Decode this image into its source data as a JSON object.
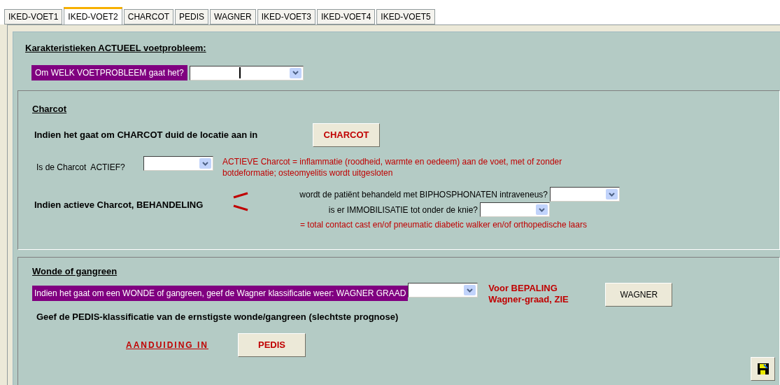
{
  "tabs": [
    {
      "label": "IKED-VOET1",
      "selected": false
    },
    {
      "label": "IKED-VOET2",
      "selected": true
    },
    {
      "label": "CHARCOT",
      "selected": false
    },
    {
      "label": "PEDIS",
      "selected": false
    },
    {
      "label": "WAGNER",
      "selected": false
    },
    {
      "label": "IKED-VOET3",
      "selected": false
    },
    {
      "label": "IKED-VOET4",
      "selected": false
    },
    {
      "label": "IKED-VOET5",
      "selected": false
    }
  ],
  "heading": "Karakteristieken ACTUEEL voetprobleem:",
  "problem_question": {
    "label": "Om WELK VOETPROBLEEM gaat het?",
    "focused": true
  },
  "charcot": {
    "title": "Charcot",
    "location_label": "Indien het gaat om CHARCOT duid de locatie aan in",
    "location_button": "CHARCOT",
    "active_label": "Is de Charcot  ACTIEF?",
    "active_note": "ACTIEVE Charcot = inflammatie (roodheid, warmte en oedeem) aan de voet, met of zonder botdeformatie; osteomyelitis wordt uitgesloten",
    "treatment_label": "Indien actieve Charcot, BEHANDELING",
    "biphosphonates_label": "wordt de patiënt behandeld met BIPHOSPHONATEN intraveneus?",
    "immobilisation_label": "is er IMMOBILISATIE tot onder de knie?",
    "immobilisation_note": "= total contact cast en/of pneumatic diabetic walker en/of orthopedische laars"
  },
  "wound": {
    "title": "Wonde of gangreen",
    "wagner_label": "Indien het gaat om een WONDE of gangreen, geef de Wagner klassificatie weer: WAGNER GRAAD",
    "wagner_note": "Voor BEPALING Wagner-graad, ZIE",
    "wagner_button": "WAGNER",
    "pedis_label": "Geef de PEDIS-klassificatie van de ernstigste wonde/gangreen (slechtste prognose)",
    "pedis_prefix": "AANDUIDING IN",
    "pedis_button": "PEDIS"
  }
}
